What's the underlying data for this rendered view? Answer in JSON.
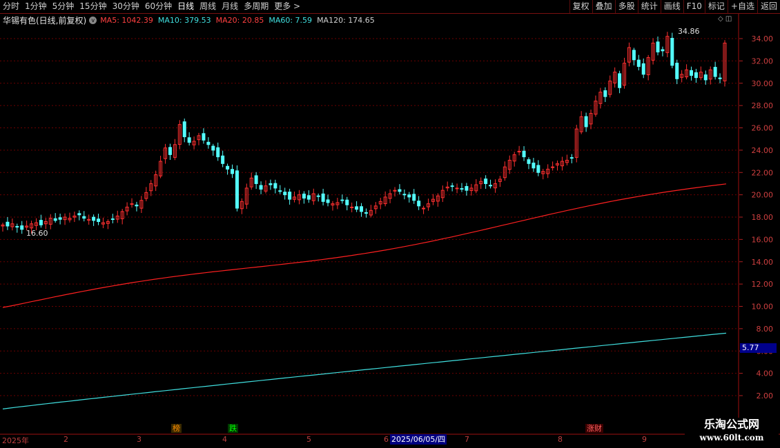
{
  "toolbar": {
    "periods": [
      "分时",
      "1分钟",
      "5分钟",
      "15分钟",
      "30分钟",
      "60分钟",
      "日线",
      "周线",
      "月线",
      "多周期",
      "更多 >"
    ],
    "tools": [
      "复权",
      "叠加",
      "多股",
      "统计",
      "画线",
      "F10",
      "标记",
      "+自选",
      "返回"
    ]
  },
  "info": {
    "stock_name": "华锡有色(日线,前复权)",
    "toggle_icon": "v",
    "ma5": "MA5: 1042.39",
    "ma10": "MA10: 379.53",
    "ma20": "MA20: 20.85",
    "ma60": "MA60: 7.59",
    "ma120": "MA120: 174.65"
  },
  "right_icons": "◇ ◫",
  "price_cursor": "5.77",
  "annotations": {
    "high": "34.86",
    "low": "16.60"
  },
  "months": [
    "2025年",
    "2",
    "3",
    "4",
    "5",
    "6",
    "7",
    "8",
    "9"
  ],
  "date_cursor": "2025/06/05/四",
  "events": [
    {
      "label": "榜",
      "color": "#ff8c00",
      "bg": "#3a2a00"
    },
    {
      "label": "跌",
      "color": "#00ff00",
      "bg": "#003a00"
    },
    {
      "label": "涨财",
      "color": "#ff6060",
      "bg": "#3a0000"
    }
  ],
  "watermark": {
    "line1": "乐淘公式网",
    "line2": "www.60lt.com"
  },
  "colors": {
    "up": "#ff3030",
    "down": "#54ffff",
    "grid": "#7a0000",
    "ma_red": "#ff2020",
    "ma_cyan": "#40e0e0"
  },
  "chart_data": {
    "type": "candlestick",
    "y_ticks": [
      "34.00",
      "32.00",
      "30.00",
      "28.00",
      "26.00",
      "24.00",
      "22.00",
      "20.00",
      "18.00",
      "16.00",
      "14.00",
      "12.00",
      "10.00",
      "8.00",
      "6.00",
      "4.00",
      "2.00"
    ],
    "ylim": [
      0.8,
      35.8
    ],
    "closes": [
      17.3,
      17.2,
      17.4,
      17.1,
      16.9,
      17.2,
      17.4,
      17.5,
      17.3,
      17.6,
      17.9,
      17.7,
      17.8,
      18.0,
      17.9,
      18.1,
      18.2,
      17.9,
      17.8,
      17.7,
      17.6,
      17.5,
      17.6,
      17.8,
      18.1,
      18.5,
      18.9,
      19.2,
      19.0,
      19.5,
      20.2,
      21.0,
      21.8,
      23.0,
      24.2,
      23.6,
      24.5,
      26.3,
      25.2,
      24.7,
      24.8,
      25.3,
      24.9,
      24.5,
      24.0,
      23.4,
      22.8,
      22.3,
      21.9,
      18.8,
      19.4,
      20.6,
      21.5,
      21.0,
      20.5,
      20.8,
      20.9,
      20.6,
      20.3,
      20.0,
      19.6,
      19.8,
      20.0,
      19.7,
      19.6,
      20.1,
      19.9,
      19.4,
      19.3,
      19.2,
      19.3,
      19.5,
      19.1,
      18.9,
      18.7,
      18.5,
      18.4,
      18.6,
      19.0,
      19.4,
      19.8,
      20.1,
      20.4,
      20.3,
      20.0,
      19.8,
      19.5,
      19.0,
      18.8,
      19.2,
      19.6,
      19.9,
      20.4,
      20.7,
      20.8,
      20.6,
      20.5,
      20.4,
      20.6,
      20.9,
      21.2,
      21.0,
      20.8,
      21.0,
      21.4,
      22.5,
      23.1,
      23.6,
      23.9,
      23.4,
      22.8,
      22.4,
      22.0,
      22.1,
      22.3,
      22.5,
      22.8,
      23.0,
      23.1,
      23.3,
      25.9,
      27.0,
      26.1,
      27.3,
      28.4,
      29.2,
      28.8,
      30.2,
      31.0,
      29.6,
      31.8,
      33.2,
      32.1,
      31.5,
      30.8,
      32.3,
      33.6,
      32.8,
      32.9,
      34.2,
      31.6,
      30.4,
      30.8,
      31.2,
      30.7,
      30.5,
      31.0,
      30.3,
      31.2,
      30.6,
      30.4,
      33.6
    ],
    "ma_red_start": 9.9,
    "ma_red_end": 20.8,
    "ma_cyan_start": 0.8,
    "ma_cyan_end": 7.6,
    "high": 34.86,
    "low": 16.6
  }
}
